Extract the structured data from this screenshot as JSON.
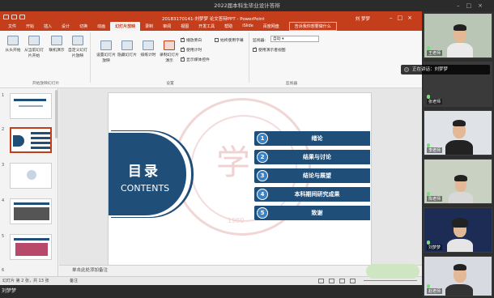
{
  "meeting": {
    "title": "2022届本科生毕业设计答辩"
  },
  "ppt": {
    "doc_title": "20183170141-刘梦梦 论文答辩PPT  -  PowerPoint",
    "user": "刘 梦梦",
    "tabs": [
      "文件",
      "开始",
      "插入",
      "设计",
      "切换",
      "动画",
      "幻灯片放映",
      "录制",
      "审阅",
      "视图",
      "开发工具",
      "帮助",
      "iSlide",
      "百度网盘",
      "告诉我你想要做什么"
    ],
    "active_tab": "iSlide",
    "ribbon": {
      "buttons": [
        {
          "label": "从头开始"
        },
        {
          "label": "从当前幻灯片开始"
        },
        {
          "label": "联机演示"
        },
        {
          "label": "自定义幻灯片放映"
        },
        {
          "label": "设置幻灯片放映"
        },
        {
          "label": "隐藏幻灯片"
        },
        {
          "label": "排练计时"
        },
        {
          "label": "录制幻灯片演示"
        }
      ],
      "checkboxes": [
        {
          "label": "播放旁白",
          "checked": true
        },
        {
          "label": "使用计时",
          "checked": true
        },
        {
          "label": "显示媒体控件",
          "checked": true
        },
        {
          "label": "始终使用字幕",
          "checked": false
        },
        {
          "label": "使用演示者视图",
          "checked": true
        }
      ],
      "monitor_label": "监视器:",
      "monitor_value": "自动",
      "groups": [
        "开始放映幻灯片",
        "设置",
        "监视器"
      ]
    },
    "slide_count_numbers": [
      "1",
      "2",
      "3",
      "4",
      "5",
      "6"
    ],
    "notes_placeholder": "单击此处添加备注",
    "status": "幻灯片 第 2 张，共 13 张",
    "status_notes": "备注",
    "slide": {
      "title_cn": "目录",
      "title_en": "CONTENTS",
      "seal_char": "学",
      "seal_year": "1980",
      "items": [
        {
          "num": "1",
          "label": "绪论"
        },
        {
          "num": "2",
          "label": "结果与讨论"
        },
        {
          "num": "3",
          "label": "结论与展望"
        },
        {
          "num": "4",
          "label": "本科期间研究成果"
        },
        {
          "num": "5",
          "label": "致谢"
        }
      ]
    }
  },
  "toast": "正在讲话：刘梦梦",
  "participants": [
    {
      "name": "王老师"
    },
    {
      "name": "张老师"
    },
    {
      "name": "李老师"
    },
    {
      "name": "陈老师"
    },
    {
      "name": "刘梦梦"
    },
    {
      "name": "赵老师"
    }
  ],
  "bottom_text": "刘梦梦"
}
